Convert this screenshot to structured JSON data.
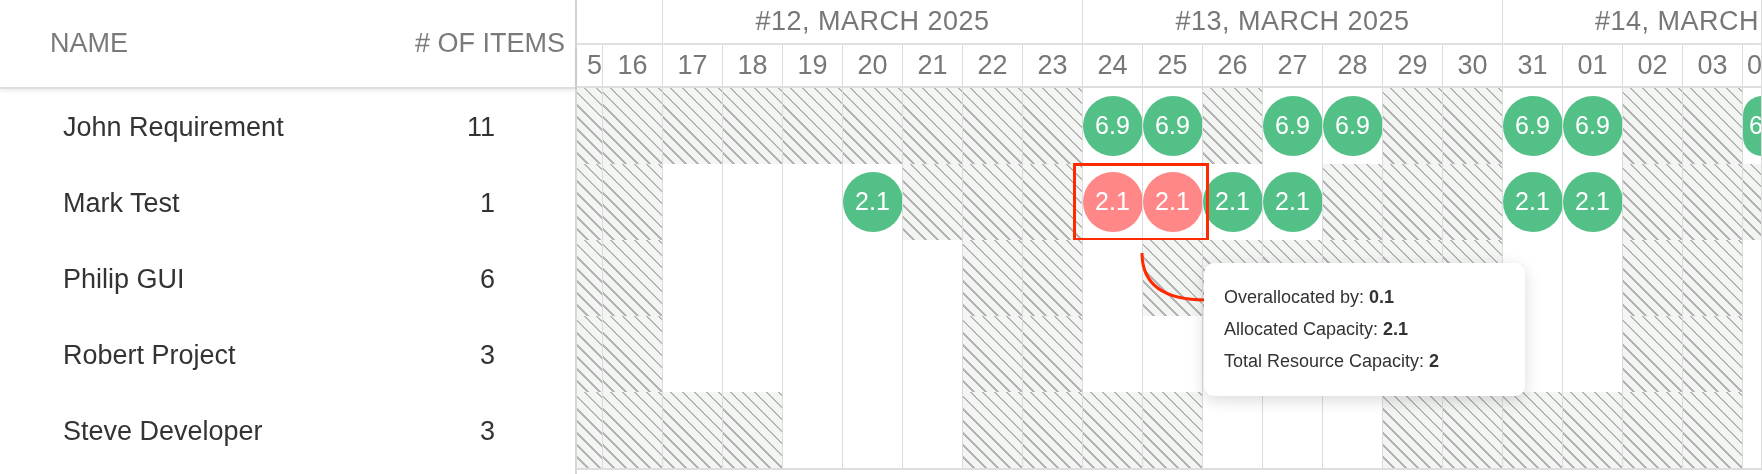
{
  "list_header": {
    "name": "NAME",
    "items": "# OF ITEMS"
  },
  "weeks": [
    "#12, MARCH 2025",
    "#13, MARCH 2025",
    "#14, MARCH"
  ],
  "days": [
    "5",
    "16",
    "17",
    "18",
    "19",
    "20",
    "21",
    "22",
    "23",
    "24",
    "25",
    "26",
    "27",
    "28",
    "29",
    "30",
    "31",
    "01",
    "02",
    "03",
    "0"
  ],
  "rows": [
    {
      "name": "John Requirement",
      "items": "11",
      "cells": [
        {
          "hatched": true
        },
        {
          "hatched": true
        },
        {
          "hatched": true
        },
        {
          "hatched": true
        },
        {
          "hatched": true
        },
        {
          "hatched": true
        },
        {
          "hatched": true
        },
        {
          "hatched": true
        },
        {
          "hatched": true
        },
        {
          "hatched": false,
          "value": "6.9",
          "kind": "ok"
        },
        {
          "hatched": false,
          "value": "6.9",
          "kind": "ok"
        },
        {
          "hatched": true
        },
        {
          "hatched": false,
          "value": "6.9",
          "kind": "ok"
        },
        {
          "hatched": false,
          "value": "6.9",
          "kind": "ok"
        },
        {
          "hatched": true
        },
        {
          "hatched": true
        },
        {
          "hatched": false,
          "value": "6.9",
          "kind": "ok"
        },
        {
          "hatched": false,
          "value": "6.9",
          "kind": "ok"
        },
        {
          "hatched": true
        },
        {
          "hatched": true
        },
        {
          "hatched": false,
          "value": "6",
          "kind": "ok"
        }
      ]
    },
    {
      "name": "Mark Test",
      "items": "1",
      "cells": [
        {
          "hatched": true
        },
        {
          "hatched": true
        },
        {
          "hatched": false
        },
        {
          "hatched": false
        },
        {
          "hatched": false
        },
        {
          "hatched": false,
          "value": "2.1",
          "kind": "ok"
        },
        {
          "hatched": true
        },
        {
          "hatched": true
        },
        {
          "hatched": true
        },
        {
          "hatched": false,
          "value": "2.1",
          "kind": "over",
          "highlighted": true
        },
        {
          "hatched": false,
          "value": "2.1",
          "kind": "over",
          "highlighted": true
        },
        {
          "hatched": false,
          "value": "2.1",
          "kind": "ok"
        },
        {
          "hatched": false,
          "value": "2.1",
          "kind": "ok"
        },
        {
          "hatched": true
        },
        {
          "hatched": true
        },
        {
          "hatched": true
        },
        {
          "hatched": false,
          "value": "2.1",
          "kind": "ok"
        },
        {
          "hatched": false,
          "value": "2.1",
          "kind": "ok"
        },
        {
          "hatched": true
        },
        {
          "hatched": true
        },
        {
          "hatched": true
        }
      ]
    },
    {
      "name": "Philip GUI",
      "items": "6",
      "cells": [
        {
          "hatched": true
        },
        {
          "hatched": true
        },
        {
          "hatched": false
        },
        {
          "hatched": false
        },
        {
          "hatched": false
        },
        {
          "hatched": false
        },
        {
          "hatched": false
        },
        {
          "hatched": true
        },
        {
          "hatched": true
        },
        {
          "hatched": false
        },
        {
          "hatched": true
        },
        {
          "hatched": true
        },
        {
          "hatched": true
        },
        {
          "hatched": true
        },
        {
          "hatched": true
        },
        {
          "hatched": true
        },
        {
          "hatched": false
        },
        {
          "hatched": false
        },
        {
          "hatched": true
        },
        {
          "hatched": true
        },
        {
          "hatched": false
        }
      ]
    },
    {
      "name": "Robert Project",
      "items": "3",
      "cells": [
        {
          "hatched": true
        },
        {
          "hatched": true
        },
        {
          "hatched": false
        },
        {
          "hatched": false
        },
        {
          "hatched": false
        },
        {
          "hatched": false
        },
        {
          "hatched": false
        },
        {
          "hatched": true
        },
        {
          "hatched": true
        },
        {
          "hatched": false
        },
        {
          "hatched": false
        },
        {},
        {},
        {},
        {},
        {},
        {
          "hatched": false
        },
        {
          "hatched": false
        },
        {
          "hatched": true
        },
        {
          "hatched": true
        },
        {
          "hatched": false
        }
      ]
    },
    {
      "name": "Steve Developer",
      "items": "3",
      "cells": [
        {
          "hatched": true
        },
        {
          "hatched": true
        },
        {
          "hatched": true
        },
        {
          "hatched": true
        },
        {
          "hatched": false
        },
        {
          "hatched": false
        },
        {
          "hatched": false
        },
        {
          "hatched": true
        },
        {
          "hatched": true
        },
        {
          "hatched": true
        },
        {
          "hatched": true
        },
        {
          "hatched": false
        },
        {
          "hatched": false
        },
        {
          "hatched": false
        },
        {
          "hatched": true
        },
        {
          "hatched": true
        },
        {
          "hatched": true
        },
        {
          "hatched": true
        },
        {
          "hatched": true
        },
        {
          "hatched": true
        },
        {
          "hatched": false
        }
      ]
    }
  ],
  "tooltip": [
    "Overallocated by: **0.1**",
    "Allocated Capacity: **2.1**",
    "Total Resource Capacity: **2**"
  ]
}
